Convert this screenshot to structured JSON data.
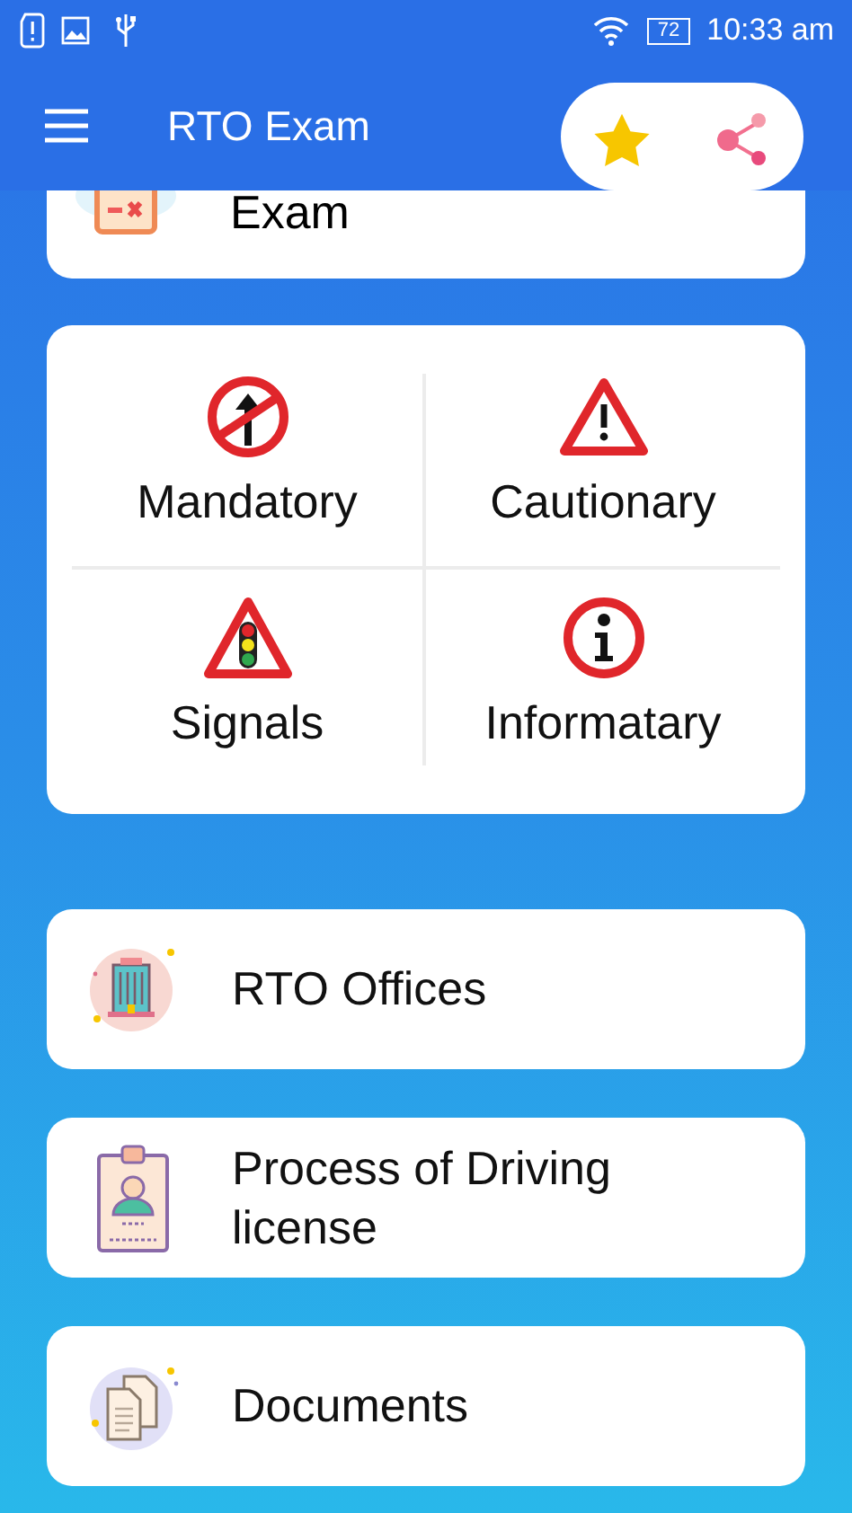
{
  "status_bar": {
    "battery": "72",
    "time": "10:33 am"
  },
  "app_bar": {
    "title": "RTO Exam"
  },
  "partial_card": {
    "label": "Exam"
  },
  "sign_grid": [
    {
      "kind": "prohibitory",
      "label": "Mandatory"
    },
    {
      "kind": "warning",
      "label": "Cautionary"
    },
    {
      "kind": "signal",
      "label": "Signals"
    },
    {
      "kind": "info",
      "label": "Informatary"
    }
  ],
  "menu_items": [
    {
      "kind": "building",
      "label": "RTO Offices"
    },
    {
      "kind": "id-card",
      "label": "Process of Driving license"
    },
    {
      "kind": "documents",
      "label": "Documents"
    }
  ]
}
